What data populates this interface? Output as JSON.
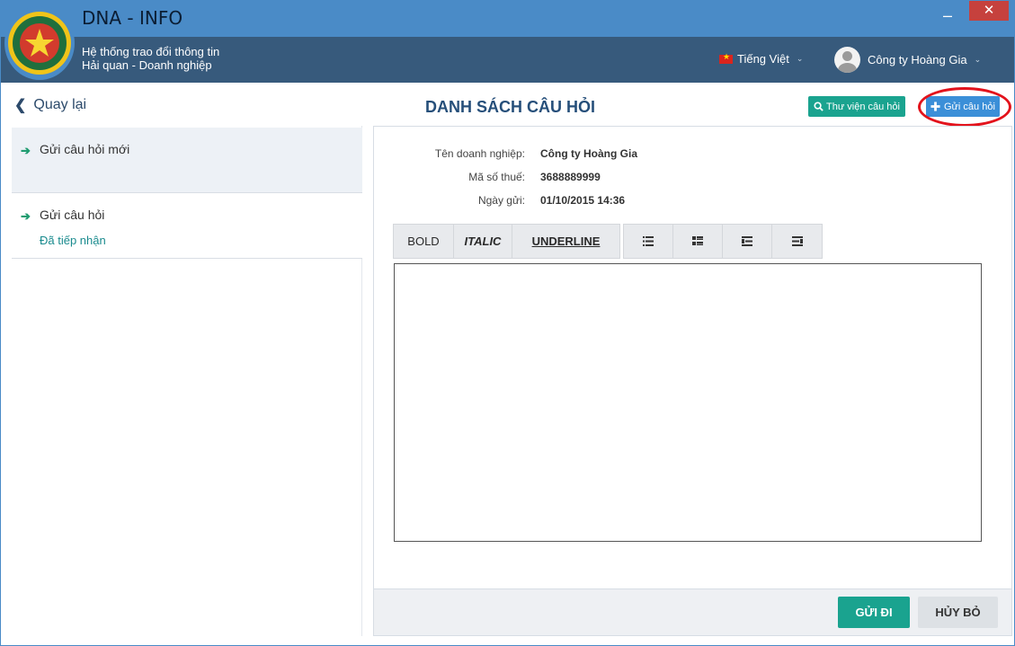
{
  "app": {
    "title": "DNA - INFO",
    "subtitle_line1": "Hệ thống trao đổi thông tin",
    "subtitle_line2": "Hải quan - Doanh nghiệp",
    "minimize": "–",
    "close": "✕"
  },
  "header": {
    "language": "Tiếng Việt",
    "user": "Công ty Hoàng Gia",
    "chevron": "⌄"
  },
  "toolbar": {
    "back_label": "Quay lại",
    "page_title": "DANH SÁCH CÂU HỎI",
    "library_label": "Thư viện câu hỏi",
    "send_question_label": "Gửi câu hỏi"
  },
  "sidebar": {
    "items": [
      {
        "label": "Gửi câu hỏi mới",
        "sub": ""
      },
      {
        "label": "Gửi câu hỏi",
        "sub": "Đã tiếp nhận"
      }
    ]
  },
  "form": {
    "company_label": "Tên doanh nghiệp:",
    "company_value": "Công ty Hoàng Gia",
    "tax_label": "Mã số thuế:",
    "tax_value": "3688889999",
    "date_label": "Ngày gửi:",
    "date_value": "01/10/2015 14:36"
  },
  "editor": {
    "bold": "BOLD",
    "italic": "ITALIC",
    "underline": "UNDERLINE",
    "icons": [
      "unordered-list-icon",
      "ordered-list-icon",
      "outdent-icon",
      "indent-icon"
    ],
    "content": ""
  },
  "actions": {
    "send_label": "GỬI ĐI",
    "cancel_label": "HỦY BỎ"
  },
  "colors": {
    "header_bg": "#375a7c",
    "titlebar_bg": "#4a8bc7",
    "accent_green": "#1aa38f",
    "accent_blue": "#3b8fd8",
    "highlight_red": "#e3131c"
  }
}
